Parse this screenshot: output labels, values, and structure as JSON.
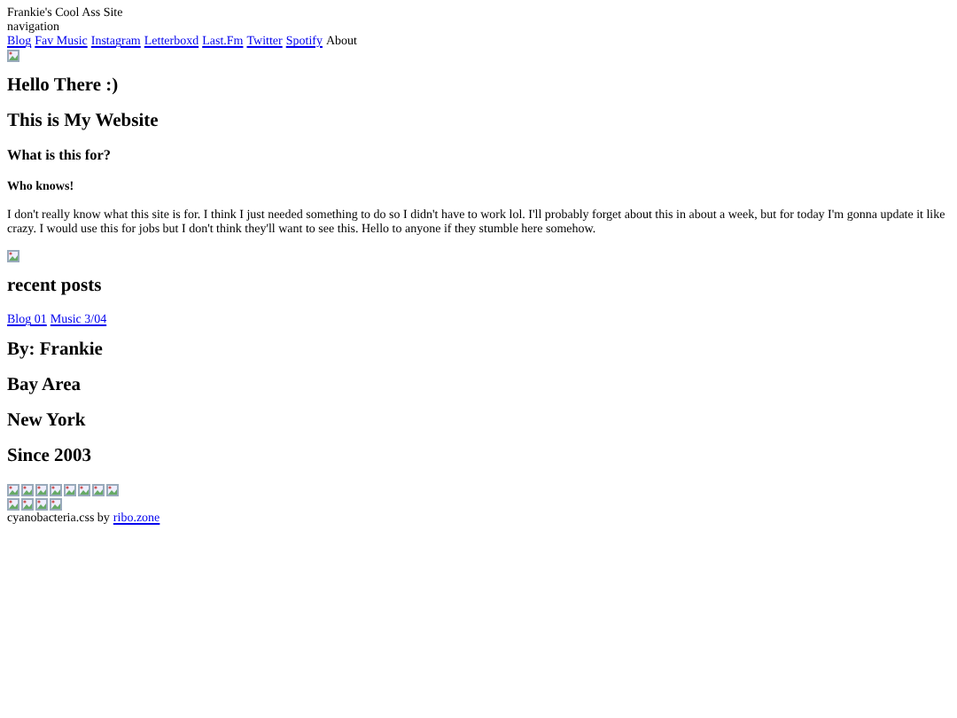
{
  "site_title": "Frankie's Cool Ass Site",
  "nav_label": "navigation",
  "nav": [
    {
      "label": "Blog",
      "selected": false
    },
    {
      "label": "Fav Music",
      "selected": false
    },
    {
      "label": "Instagram",
      "selected": false
    },
    {
      "label": "Letterboxd",
      "selected": false
    },
    {
      "label": "Last.Fm",
      "selected": false
    },
    {
      "label": "Twitter",
      "selected": false
    },
    {
      "label": "Spotify",
      "selected": false
    },
    {
      "label": "About",
      "selected": true
    }
  ],
  "headings": [
    "Hello There :)",
    "This is My Website"
  ],
  "question": "What is this for?",
  "subquestion": "Who knows!",
  "paragraph": "I don't really know what this site is for. I think I just needed something to do so I didn't have to work lol. I'll probably forget about this in about a week, but for today I'm gonna update it like crazy. I would use this for jobs but I don't think they'll want to see this. Hello to anyone if they stumble here somehow.",
  "recent_title": "recent posts",
  "posts": [
    "Blog 01",
    "Music 3/04"
  ],
  "facts": [
    "By: Frankie",
    "Bay Area",
    "New York",
    "Since 2003"
  ],
  "credit": {
    "text": "cyanobacteria.css by",
    "link": "ribo.zone"
  }
}
